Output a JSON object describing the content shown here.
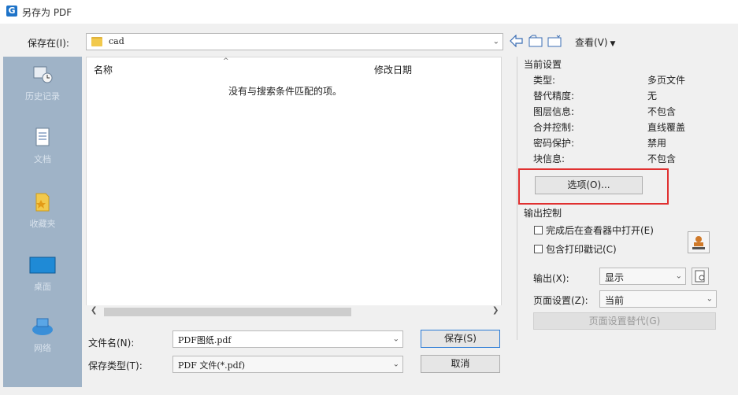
{
  "window": {
    "app_icon": "G",
    "title": "另存为 PDF"
  },
  "location": {
    "label": "保存在(I):",
    "folder": "cad",
    "view_label": "查看(V)",
    "icons": [
      "back-arrow-icon",
      "up-folder-icon",
      "new-folder-icon",
      "view-menu-icon"
    ]
  },
  "places": [
    {
      "label": "历史记录",
      "icon": "history-icon"
    },
    {
      "label": "文档",
      "icon": "documents-icon"
    },
    {
      "label": "收藏夹",
      "icon": "favorites-icon"
    },
    {
      "label": "桌面",
      "icon": "desktop-icon"
    },
    {
      "label": "网络",
      "icon": "network-icon"
    }
  ],
  "filelist": {
    "col_name": "名称",
    "col_date": "修改日期",
    "empty_text": "没有与搜索条件匹配的项。"
  },
  "filename": {
    "label": "文件名(N):",
    "value": "PDF图纸.pdf"
  },
  "filetype": {
    "label": "保存类型(T):",
    "value": "PDF 文件(*.pdf)"
  },
  "buttons": {
    "save": "保存(S)",
    "cancel": "取消"
  },
  "current_settings": {
    "title": "当前设置",
    "rows": [
      {
        "key": "类型:",
        "value": "多页文件"
      },
      {
        "key": "替代精度:",
        "value": "无"
      },
      {
        "key": "图层信息:",
        "value": "不包含"
      },
      {
        "key": "合并控制:",
        "value": "直线覆盖"
      },
      {
        "key": "密码保护:",
        "value": "禁用"
      },
      {
        "key": "块信息:",
        "value": "不包含"
      }
    ],
    "options_button": "选项(O)..."
  },
  "output_control": {
    "title": "输出控制",
    "open_in_viewer": "完成后在查看器中打开(E)",
    "include_stamp": "包含打印戳记(C)",
    "output_label": "输出(X):",
    "output_value": "显示",
    "page_setup_label": "页面设置(Z):",
    "page_setup_value": "当前",
    "page_setup_override": "页面设置替代(G)"
  },
  "colors": {
    "highlight_box": "#e03030",
    "places_bg": "#9fb3c7"
  }
}
